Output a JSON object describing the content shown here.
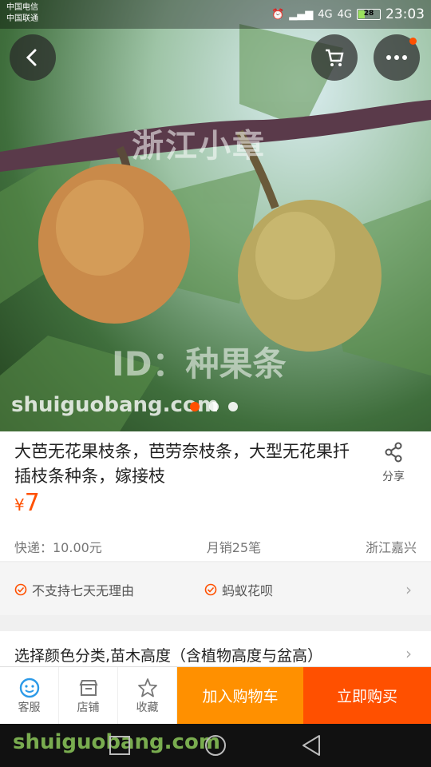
{
  "status_bar": {
    "carrier_1": "中国电信",
    "carrier_2": "中国联通",
    "network_1": "4G",
    "network_2": "4G",
    "battery": "28",
    "time": "23:03"
  },
  "hero": {
    "watermark_1": "浙江小章",
    "watermark_2": "ID：种果条",
    "watermark_3": "shuiguobang.com",
    "image_count": 3,
    "active_image": 1
  },
  "product": {
    "title": "大芭无花果枝条，芭劳奈枝条，大型无花果扦插枝条种条，嫁接枝",
    "share_label": "分享",
    "currency": "¥",
    "price": "7",
    "shipping": "快递：10.00元",
    "monthly_sales": "月销25笔",
    "location": "浙江嘉兴"
  },
  "services": {
    "item_1": "不支持七天无理由",
    "item_2": "蚂蚁花呗"
  },
  "options": {
    "select_label": "选择颜色分类,苗木高度（含植物高度与盆高）"
  },
  "action_bar": {
    "service_label": "客服",
    "shop_label": "店铺",
    "favorite_label": "收藏",
    "add_to_cart_label": "加入购物车",
    "buy_now_label": "立即购买"
  },
  "colors": {
    "accent": "#ff5000",
    "cart_orange": "#ff9000",
    "service_blue": "#2c9ae8"
  }
}
